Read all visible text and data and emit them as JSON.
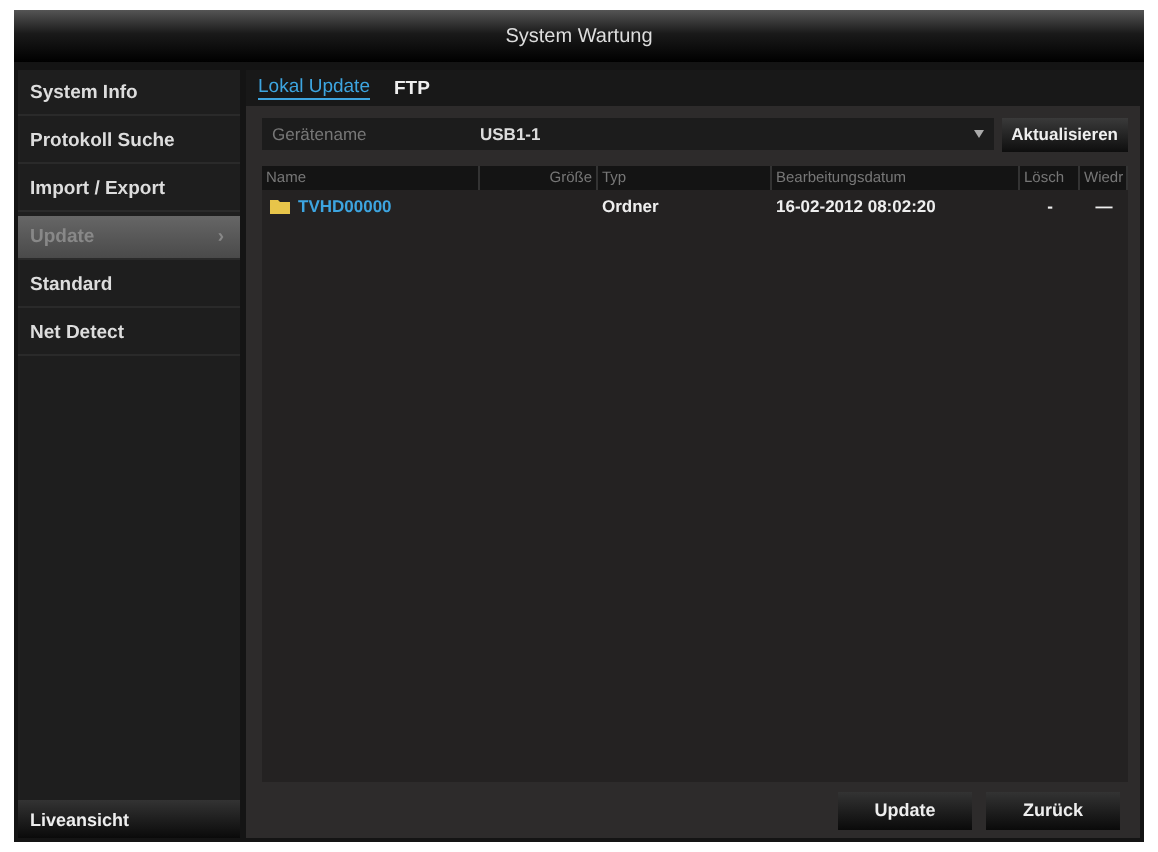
{
  "window": {
    "title": "System Wartung"
  },
  "sidebar": {
    "items": [
      {
        "label": "System Info",
        "selected": false
      },
      {
        "label": "Protokoll Suche",
        "selected": false
      },
      {
        "label": "Import / Export",
        "selected": false
      },
      {
        "label": "Update",
        "selected": true,
        "arrow": "›"
      },
      {
        "label": "Standard",
        "selected": false
      },
      {
        "label": "Net Detect",
        "selected": false
      }
    ],
    "bottom_button": "Liveansicht"
  },
  "tabs": [
    {
      "label": "Lokal Update",
      "selected": true
    },
    {
      "label": "FTP",
      "selected": false
    }
  ],
  "device": {
    "label": "Gerätename",
    "value": "USB1-1",
    "button": "Aktualisieren"
  },
  "table": {
    "columns": [
      "Name",
      "Größe",
      "Typ",
      "Bearbeitungsdatum",
      "Lösch",
      "Wiedr"
    ],
    "rows": [
      {
        "name": "TVHD00000",
        "type": "Ordner",
        "date": "16-02-2012 08:02:20",
        "delete": "-",
        "restore": "—"
      }
    ]
  },
  "buttons": [
    "Update",
    "Zurück"
  ]
}
